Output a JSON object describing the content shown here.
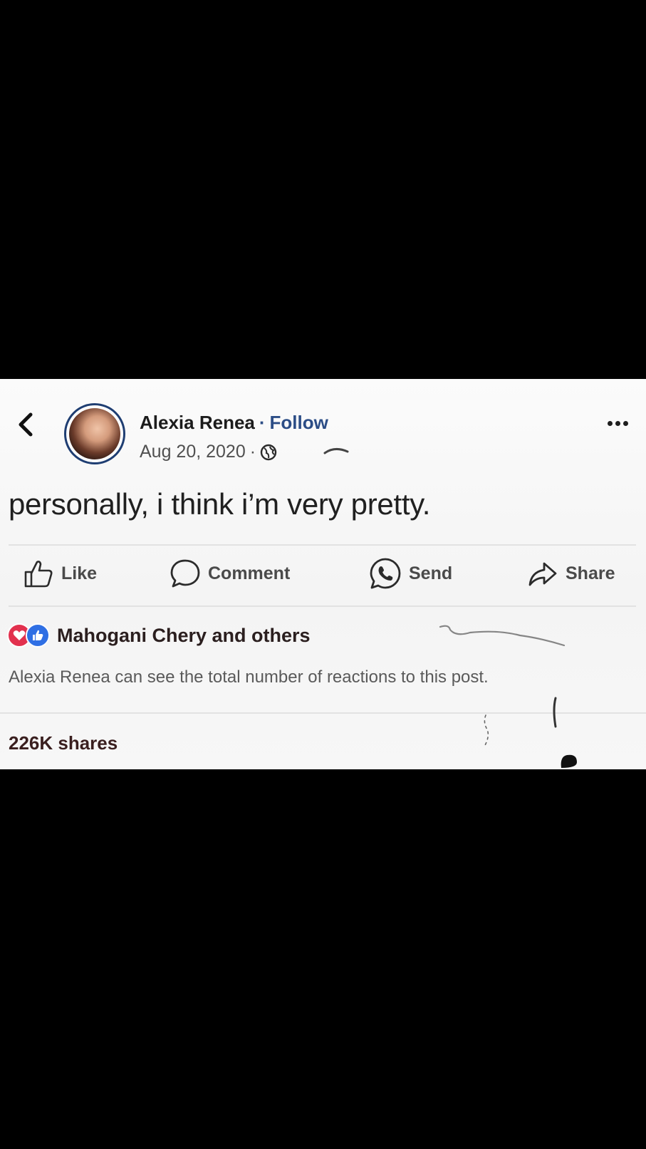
{
  "post": {
    "author_name": "Alexia Renea",
    "separator": "·",
    "follow_label": "Follow",
    "date": "Aug 20, 2020",
    "date_separator": "·",
    "privacy_icon": "globe-icon",
    "text": "personally, i think i’m very pretty."
  },
  "actions": {
    "like_label": "Like",
    "comment_label": "Comment",
    "send_label": "Send",
    "share_label": "Share"
  },
  "reactions": {
    "icons": [
      "heart-icon",
      "thumbs-up-icon"
    ],
    "summary": "Mahogani Chery and others",
    "note": "Alexia Renea can see the total number of reactions to this post."
  },
  "shares": {
    "label": "226K shares"
  },
  "colors": {
    "follow": "#2c4d86",
    "avatar_ring": "#1f3e72",
    "love": "#e2314e",
    "like": "#2f6fe4"
  }
}
